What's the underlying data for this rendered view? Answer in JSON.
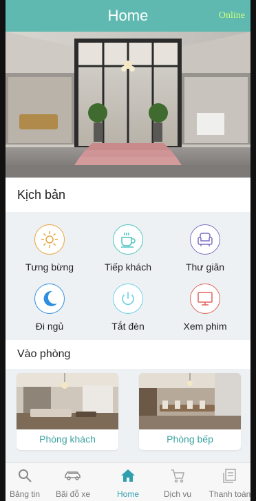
{
  "header": {
    "title": "Home",
    "status": "Online"
  },
  "scenarios": {
    "title": "Kịch bản",
    "items": [
      {
        "label": "Tưng bừng",
        "icon": "sun-icon",
        "color": "#e8a33c"
      },
      {
        "label": "Tiếp khách",
        "icon": "coffee-cup-icon",
        "color": "#4cc3c0"
      },
      {
        "label": "Thư giãn",
        "icon": "armchair-icon",
        "color": "#7b6fc4"
      },
      {
        "label": "Đi ngủ",
        "icon": "moon-icon",
        "color": "#2e8fe0"
      },
      {
        "label": "Tắt đèn",
        "icon": "power-icon",
        "color": "#6ad0e6"
      },
      {
        "label": "Xem phim",
        "icon": "monitor-icon",
        "color": "#e0625a"
      }
    ]
  },
  "rooms": {
    "title": "Vào phòng",
    "items": [
      {
        "label": "Phòng khách"
      },
      {
        "label": "Phòng bếp"
      }
    ]
  },
  "tabbar": {
    "items": [
      {
        "label": "Bảng tin",
        "icon": "search-icon"
      },
      {
        "label": "Bãi đỗ xe",
        "icon": "car-icon"
      },
      {
        "label": "Home",
        "icon": "home-icon"
      },
      {
        "label": "Dịch vụ",
        "icon": "cart-icon"
      },
      {
        "label": "Thanh toán",
        "icon": "receipt-icon"
      }
    ],
    "active_label": "Home",
    "active_color": "#2f9fb0"
  },
  "colors": {
    "header": "#5fb9b1",
    "status": "#c9ff7a",
    "accent": "#3aa3a0"
  }
}
